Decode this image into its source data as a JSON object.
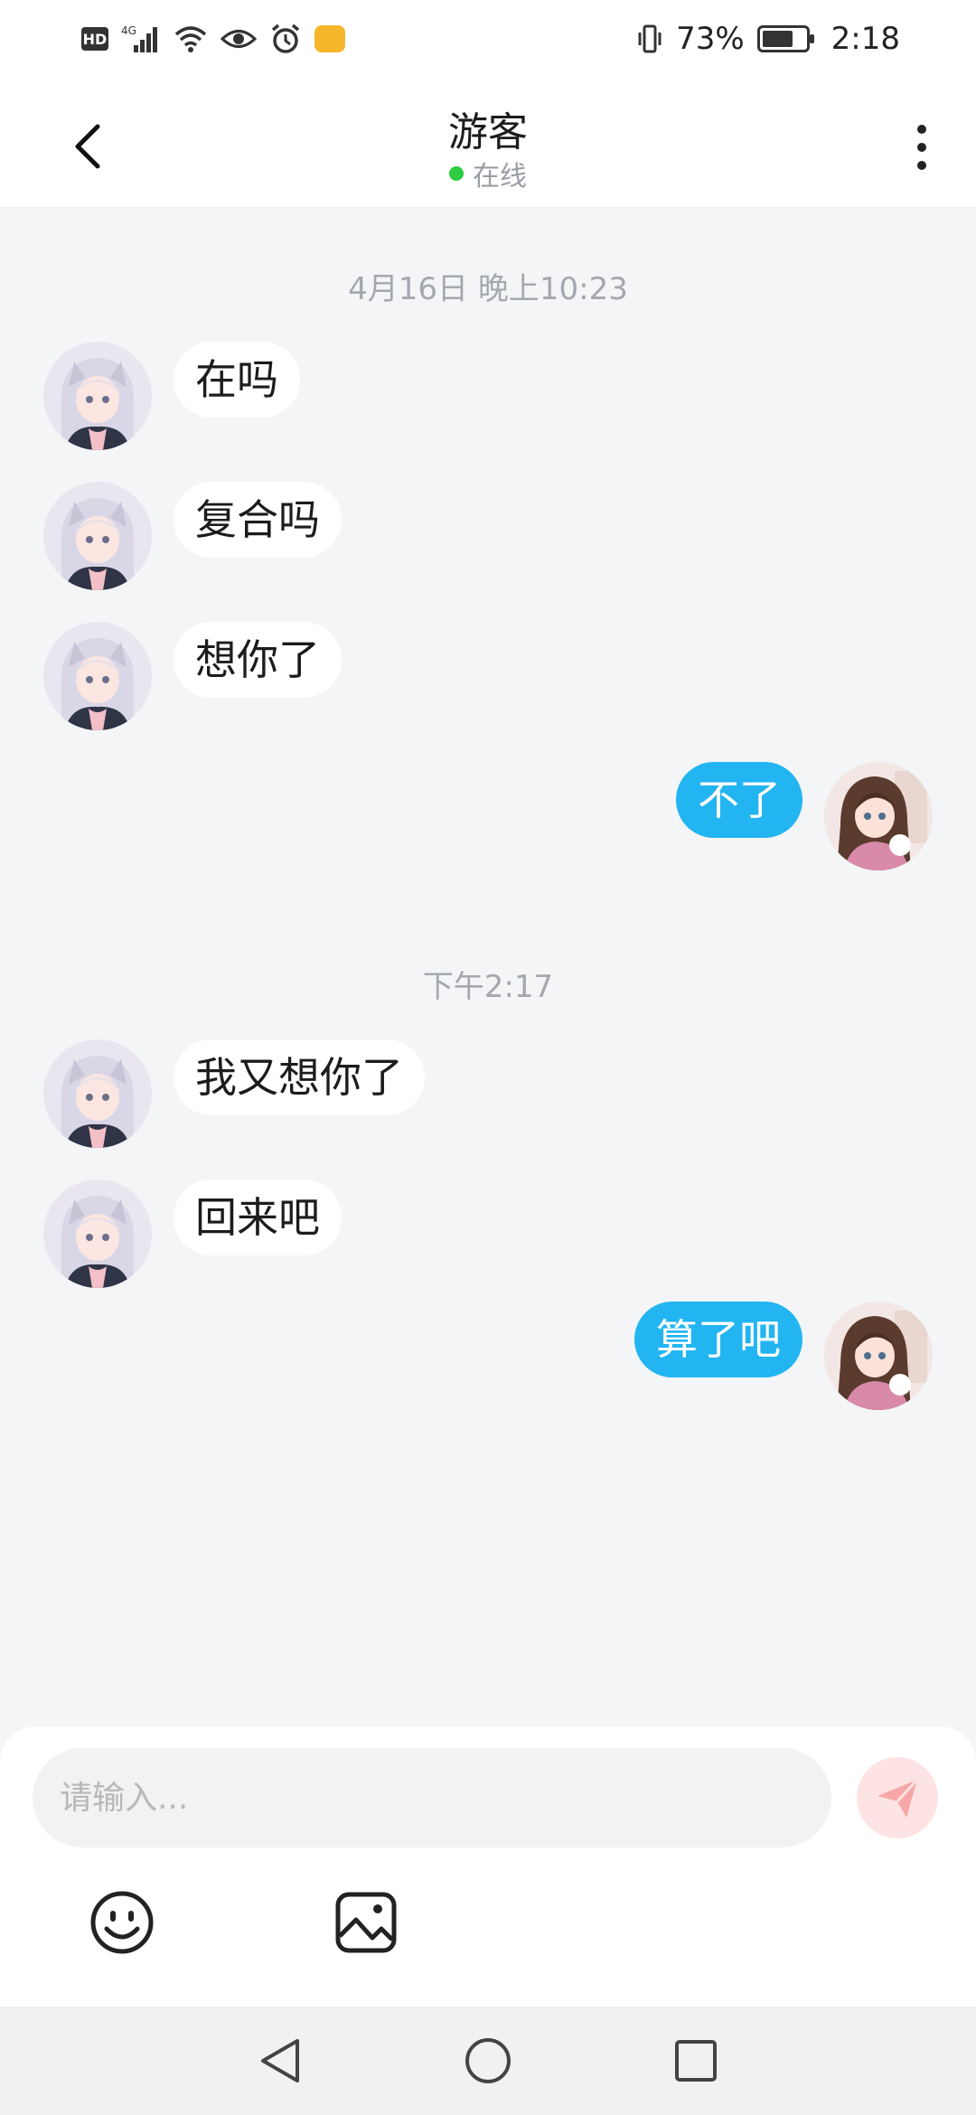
{
  "status_bar": {
    "network": "4G",
    "battery_percent": "73%",
    "battery_level": 0.73,
    "time": "2:18",
    "icons": [
      "hd-icon",
      "signal-icon",
      "wifi-icon",
      "eye-icon",
      "alarm-icon",
      "app-notification-icon",
      "vibrate-icon",
      "battery-charging-icon"
    ]
  },
  "header": {
    "title": "游客",
    "status": "在线",
    "status_color": "#2ecc40"
  },
  "chat": {
    "sections": [
      {
        "timestamp": "4月16日 晚上10:23",
        "messages": [
          {
            "sender": "other",
            "text": "在吗"
          },
          {
            "sender": "other",
            "text": "复合吗"
          },
          {
            "sender": "other",
            "text": "想你了"
          },
          {
            "sender": "me",
            "text": "不了"
          }
        ]
      },
      {
        "timestamp": "下午2:17",
        "messages": [
          {
            "sender": "other",
            "text": "我又想你了"
          },
          {
            "sender": "other",
            "text": "回来吧"
          },
          {
            "sender": "me",
            "text": "算了吧"
          }
        ]
      }
    ]
  },
  "composer": {
    "placeholder": "请输入...",
    "value": ""
  },
  "colors": {
    "accent": "#23b5f2",
    "send_button_bg": "#fde3e3",
    "send_icon": "#f7a7a7",
    "background": "#f4f5f7"
  }
}
